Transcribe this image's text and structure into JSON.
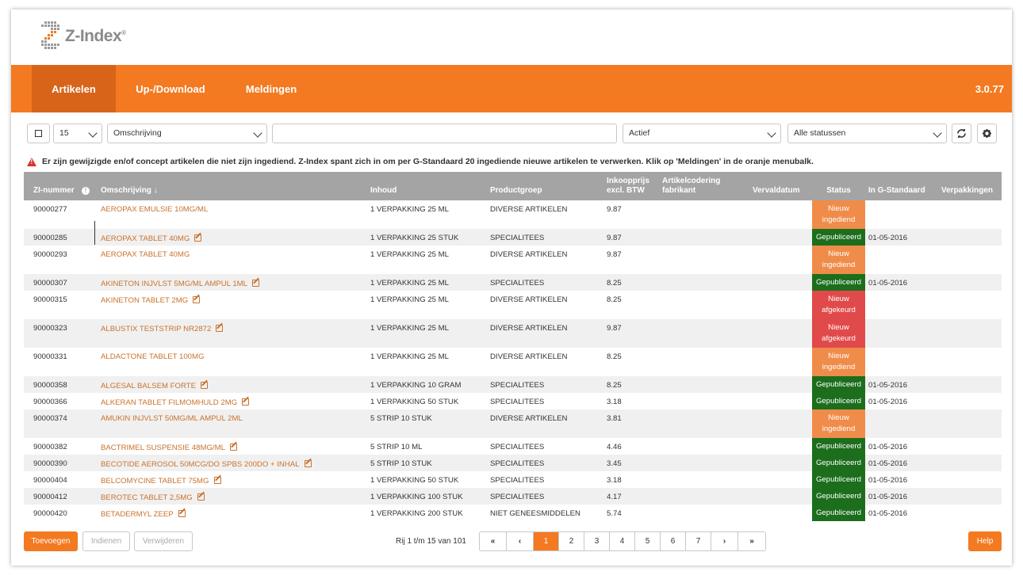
{
  "app": {
    "logo_text": "Z-Index",
    "logo_mark": "®",
    "version": "3.0.77",
    "nav": [
      {
        "label": "Artikelen",
        "active": true
      },
      {
        "label": "Up-/Download",
        "active": false
      },
      {
        "label": "Meldingen",
        "active": false
      }
    ]
  },
  "toolbar": {
    "page_size": "15",
    "search_field": "Omschrijving",
    "search_value": "",
    "state_filter": "Actief",
    "status_filter": "Alle statussen",
    "refresh_icon": "refresh-icon",
    "settings_icon": "gear-icon"
  },
  "warning": "Er zijn gewijzigde en/of concept artikelen die niet zijn ingediend. Z-Index spant zich in om per G-Standaard 20 ingediende nieuwe artikelen te verwerken. Klik op 'Meldingen' in de oranje menubalk.",
  "table": {
    "columns": {
      "zi": "ZI-nummer",
      "desc": "Omschrijving ↓",
      "content": "Inhoud",
      "group": "Productgroep",
      "price_1": "Inkoopprijs",
      "price_2": "excl. BTW",
      "code_1": "Artikelcodering",
      "code_2": "fabrikant",
      "expiry": "Vervaldatum",
      "status": "Status",
      "gstd": "In G-Standaard",
      "packs": "Verpakkingen"
    },
    "rows": [
      {
        "zi": "90000277",
        "desc": "AEROPAX EMULSIE 10MG/ML",
        "edit": false,
        "content": "1 VERPAKKING 25 ML",
        "group": "DIVERSE ARTIKELEN",
        "price": "9.87",
        "status_1": "Nieuw",
        "status_2": "ingediend",
        "status_type": "new",
        "gstd": ""
      },
      {
        "zi": "90000285",
        "desc": "AEROPAX TABLET 40MG",
        "edit": true,
        "content": "1 VERPAKKING 25 STUK",
        "group": "SPECIALITEES",
        "price": "9.87",
        "status_1": "Gepubliceerd",
        "status_2": "",
        "status_type": "pub",
        "gstd": "01-05-2016"
      },
      {
        "zi": "90000293",
        "desc": "AEROPAX TABLET 40MG",
        "edit": false,
        "content": "1 VERPAKKING 25 ML",
        "group": "DIVERSE ARTIKELEN",
        "price": "9.87",
        "status_1": "Nieuw",
        "status_2": "ingediend",
        "status_type": "new",
        "gstd": ""
      },
      {
        "zi": "90000307",
        "desc": "AKINETON INJVLST 5MG/ML AMPUL 1ML",
        "edit": true,
        "content": "1 VERPAKKING 25 ML",
        "group": "SPECIALITEES",
        "price": "8.25",
        "status_1": "Gepubliceerd",
        "status_2": "",
        "status_type": "pub",
        "gstd": "01-05-2016"
      },
      {
        "zi": "90000315",
        "desc": "AKINETON TABLET 2MG",
        "edit": true,
        "content": "1 VERPAKKING 25 ML",
        "group": "DIVERSE ARTIKELEN",
        "price": "8.25",
        "status_1": "Nieuw",
        "status_2": "afgekeurd",
        "status_type": "rej",
        "gstd": ""
      },
      {
        "zi": "90000323",
        "desc": "ALBUSTIX TESTSTRIP NR2872",
        "edit": true,
        "content": "1 VERPAKKING 25 ML",
        "group": "DIVERSE ARTIKELEN",
        "price": "9.87",
        "status_1": "Nieuw",
        "status_2": "afgekeurd",
        "status_type": "rej",
        "gstd": ""
      },
      {
        "zi": "90000331",
        "desc": "ALDACTONE TABLET 100MG",
        "edit": false,
        "content": "1 VERPAKKING 25 ML",
        "group": "DIVERSE ARTIKELEN",
        "price": "8.25",
        "status_1": "Nieuw",
        "status_2": "ingediend",
        "status_type": "new",
        "gstd": ""
      },
      {
        "zi": "90000358",
        "desc": "ALGESAL BALSEM FORTE",
        "edit": true,
        "content": "1 VERPAKKING 10 GRAM",
        "group": "SPECIALITEES",
        "price": "8.25",
        "status_1": "Gepubliceerd",
        "status_2": "",
        "status_type": "pub",
        "gstd": "01-05-2016"
      },
      {
        "zi": "90000366",
        "desc": "ALKERAN TABLET FILMOMHULD 2MG",
        "edit": true,
        "content": "1 VERPAKKING 50 STUK",
        "group": "SPECIALITEES",
        "price": "3.18",
        "status_1": "Gepubliceerd",
        "status_2": "",
        "status_type": "pub",
        "gstd": "01-05-2016"
      },
      {
        "zi": "90000374",
        "desc": "AMUKIN INJVLST 50MG/ML AMPUL 2ML",
        "edit": false,
        "content": "5 STRIP 10 STUK",
        "group": "DIVERSE ARTIKELEN",
        "price": "3.81",
        "status_1": "Nieuw",
        "status_2": "ingediend",
        "status_type": "new",
        "gstd": ""
      },
      {
        "zi": "90000382",
        "desc": "BACTRIMEL SUSPENSIE 48MG/ML",
        "edit": true,
        "content": "5 STRIP 10 ML",
        "group": "SPECIALITEES",
        "price": "4.46",
        "status_1": "Gepubliceerd",
        "status_2": "",
        "status_type": "pub",
        "gstd": "01-05-2016"
      },
      {
        "zi": "90000390",
        "desc": "BECOTIDE AEROSOL 50MCG/DO SPBS 200DO + INHAL",
        "edit": true,
        "content": "5 STRIP 10 STUK",
        "group": "SPECIALITEES",
        "price": "3.45",
        "status_1": "Gepubliceerd",
        "status_2": "",
        "status_type": "pub",
        "gstd": "01-05-2016"
      },
      {
        "zi": "90000404",
        "desc": "BELCOMYCINE TABLET 75MG",
        "edit": true,
        "content": "1 VERPAKKING 50 STUK",
        "group": "SPECIALITEES",
        "price": "3.18",
        "status_1": "Gepubliceerd",
        "status_2": "",
        "status_type": "pub",
        "gstd": "01-05-2016"
      },
      {
        "zi": "90000412",
        "desc": "BEROTEC TABLET 2,5MG",
        "edit": true,
        "content": "1 VERPAKKING 100 STUK",
        "group": "SPECIALITEES",
        "price": "4.17",
        "status_1": "Gepubliceerd",
        "status_2": "",
        "status_type": "pub",
        "gstd": "01-05-2016"
      },
      {
        "zi": "90000420",
        "desc": "BETADERMYL ZEEP",
        "edit": true,
        "content": "1 VERPAKKING 200 STUK",
        "group": "NIET GENEESMIDDELEN",
        "price": "5.74",
        "status_1": "Gepubliceerd",
        "status_2": "",
        "status_type": "pub",
        "gstd": "01-05-2016"
      }
    ]
  },
  "footer": {
    "add_label": "Toevoegen",
    "submit_label": "Indienen",
    "delete_label": "Verwijderen",
    "rows_text": "Rij 1 t/m 15 van 101",
    "first": "«",
    "prev": "‹",
    "pages": [
      "1",
      "2",
      "3",
      "4",
      "5",
      "6",
      "7"
    ],
    "active_page": "1",
    "next": "›",
    "last": "»",
    "help_label": "Help"
  },
  "colors": {
    "brand_orange": "#f37a21",
    "status_new": "#f08c4a",
    "status_rejected": "#e14a4a",
    "status_published": "#1c6e1c"
  }
}
